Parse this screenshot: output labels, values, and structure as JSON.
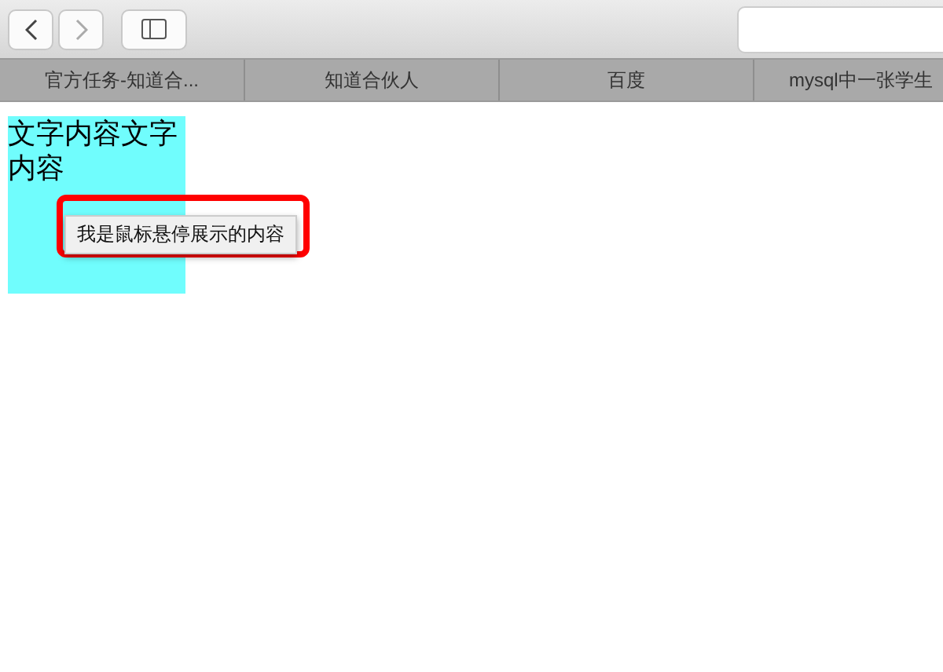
{
  "bookmarks": [
    "官方任务-知道合...",
    "知道合伙人",
    "百度",
    "mysql中一张学生"
  ],
  "content": {
    "text": "文字内容文字内容",
    "tooltip": "我是鼠标悬停展示的内容"
  }
}
